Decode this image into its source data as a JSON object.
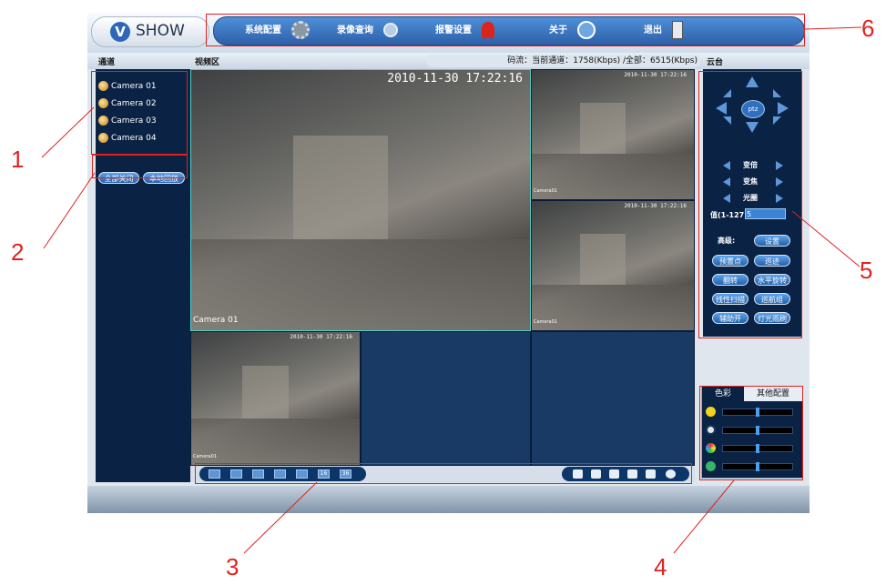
{
  "app": {
    "logo_text": "SHOW",
    "logo_mark": "V"
  },
  "menu": [
    {
      "label": "系统配置",
      "icon": "gear-icon"
    },
    {
      "label": "录像查询",
      "icon": "magnifier-icon"
    },
    {
      "label": "报警设置",
      "icon": "siren-icon"
    },
    {
      "label": "关于",
      "icon": "smiley-icon"
    },
    {
      "label": "退出",
      "icon": "door-icon"
    }
  ],
  "header": {
    "channels_title": "通道",
    "video_title": "视频区",
    "stream_info": "码流：当前通道：1758(Kbps) /全部：6515(Kbps)",
    "ptz_title": "云台"
  },
  "cameras": [
    "Camera 01",
    "Camera 02",
    "Camera 03",
    "Camera 04"
  ],
  "left_buttons": {
    "close_all": "全部关闭",
    "local_playback": "本地回放"
  },
  "video": {
    "main_timestamp": "2010-11-30  17:22:16",
    "small_timestamp": "2010-11-30  17:22:16",
    "main_label": "Camera 01",
    "small_label": "Camera01"
  },
  "toolbar": {
    "layout_16": "16",
    "layout_36": "36"
  },
  "ptz": {
    "center": "ptz",
    "zoom": "变倍",
    "focus": "变焦",
    "iris": "光圈",
    "value_label": "值(1-127):",
    "value": "5",
    "advanced": "高级:",
    "buttons": [
      "设置",
      "预置点",
      "巡迹",
      "翻转",
      "水平旋转",
      "线性扫描",
      "巡航组",
      "辅助开",
      "灯光雨刷"
    ]
  },
  "color_panel": {
    "tabs": [
      "色彩",
      "其他配置"
    ],
    "levels": {
      "brightness": 0.5,
      "contrast": 0.5,
      "saturation": 0.5,
      "hue": 0.5
    }
  },
  "callouts": [
    "1",
    "2",
    "3",
    "4",
    "5",
    "6"
  ],
  "colors": {
    "panel_bg": "#0a2244",
    "accent_blue": "#3b84d8",
    "callout_red": "#e0221f"
  }
}
